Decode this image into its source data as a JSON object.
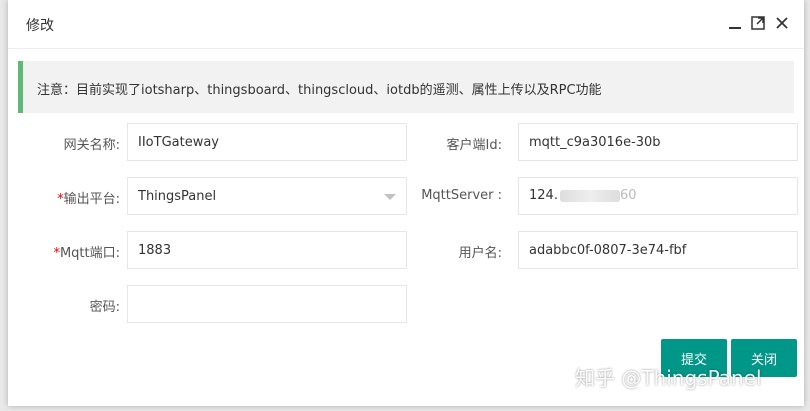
{
  "dialog": {
    "title": "修改",
    "notice": "注意：目前实现了iotsharp、thingsboard、thingscloud、iotdb的遥测、属性上传以及RPC功能"
  },
  "form": {
    "gateway_name": {
      "label": "网关名称:",
      "value": "IIoTGateway"
    },
    "client_id": {
      "label": "客户端Id:",
      "value": "mqtt_c9a3016e-30b"
    },
    "platform": {
      "required_mark": "*",
      "label": "输出平台:",
      "value": "ThingsPanel"
    },
    "mqtt_server": {
      "label": "MqttServer :",
      "value_visible_prefix": "124.",
      "value_visible_suffix": "60"
    },
    "mqtt_port": {
      "required_mark": "*",
      "label": "Mqtt端口:",
      "value": "1883"
    },
    "username": {
      "label": "用户名:",
      "value": "adabbc0f-0807-3e74-fbf"
    },
    "password": {
      "label": "密码:",
      "value": ""
    }
  },
  "buttons": {
    "submit": "提交",
    "close": "关闭"
  },
  "watermark": "知乎 @ThingsPanel",
  "colors": {
    "accent": "#009688",
    "notice_border": "#5FB878",
    "required": "#ee0000"
  }
}
